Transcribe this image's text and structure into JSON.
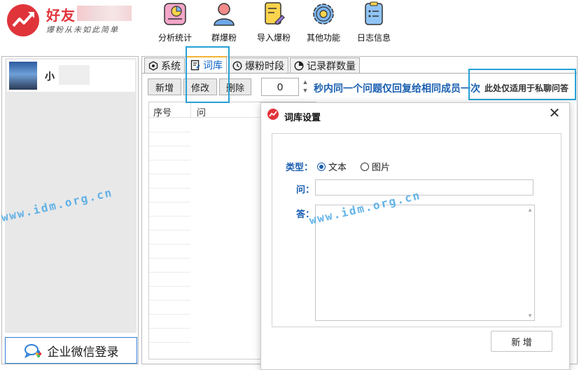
{
  "brand": {
    "name": "好友",
    "slogan": "爆粉从未如此简单"
  },
  "toolbar": {
    "items": [
      {
        "label": "分析统计",
        "icon": "chart-icon"
      },
      {
        "label": "群爆粉",
        "icon": "user-icon"
      },
      {
        "label": "导入爆粉",
        "icon": "import-file-icon"
      },
      {
        "label": "其他功能",
        "icon": "gear-icon"
      },
      {
        "label": "日志信息",
        "icon": "log-icon"
      }
    ]
  },
  "sidebar": {
    "account_name": "小",
    "wecom_login": "企业微信登录"
  },
  "tabs": [
    {
      "label": "系统",
      "icon": "shield-icon"
    },
    {
      "label": "词库",
      "icon": "wordbook-icon",
      "active": true
    },
    {
      "label": "爆粉时段",
      "icon": "clock-icon"
    },
    {
      "label": "记录群数量",
      "icon": "pie-icon"
    }
  ],
  "actions": {
    "add": "新增",
    "edit": "修改",
    "delete": "删除"
  },
  "seconds_value": "0",
  "hint": "秒内同一个问题仅回复给相同成员一次",
  "note": "此处仅适用于私聊问答",
  "table": {
    "columns": [
      "序号",
      "问"
    ]
  },
  "watermark": "www.idm.org.cn",
  "dialog": {
    "title": "词库设置",
    "type_label": "类型：",
    "type_options": [
      {
        "label": "文本",
        "selected": true
      },
      {
        "label": "图片",
        "selected": false
      }
    ],
    "question_label": "问：",
    "question_value": "",
    "answer_label": "答：",
    "answer_value": "",
    "add_button": "新 增",
    "close_glyph": "✕"
  }
}
